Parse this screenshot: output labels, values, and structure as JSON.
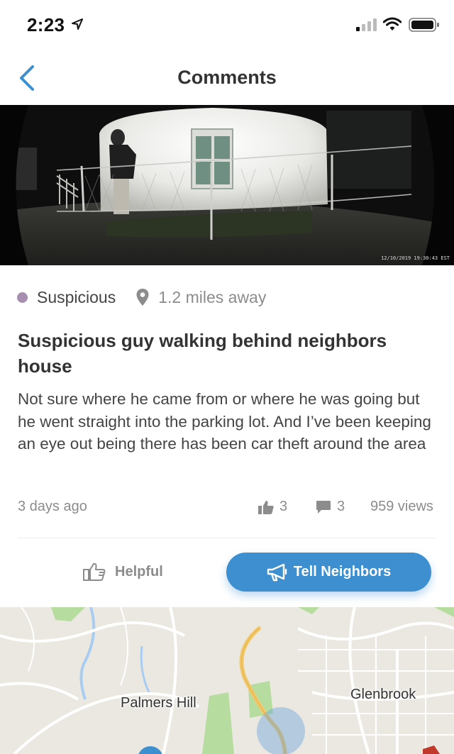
{
  "status_bar": {
    "time": "2:23",
    "icons": [
      "location-arrow-icon",
      "signal-icon",
      "wifi-icon",
      "battery-icon"
    ]
  },
  "nav": {
    "title": "Comments",
    "back_icon": "chevron-left-icon"
  },
  "video": {
    "timestamp": "12/10/2019 19:30:43 EST"
  },
  "post": {
    "category": "Suspicious",
    "category_color": "#a88fb0",
    "distance": "1.2 miles away",
    "title": "Suspicious guy walking behind neighbors house",
    "body": "Not sure where he came from or where he was going but he went straight into the parking lot. And I’ve been keeping an eye out being there has been car theft around the area",
    "time_ago": "3 days ago",
    "likes": "3",
    "comments": "3",
    "views": "959 views"
  },
  "actions": {
    "helpful_label": "Helpful",
    "tell_label": "Tell Neighbors",
    "accent_color": "#3d8fd0"
  },
  "map": {
    "labels": {
      "palmers_hill": "Palmers Hill",
      "glenbrook": "Glenbrook"
    }
  }
}
